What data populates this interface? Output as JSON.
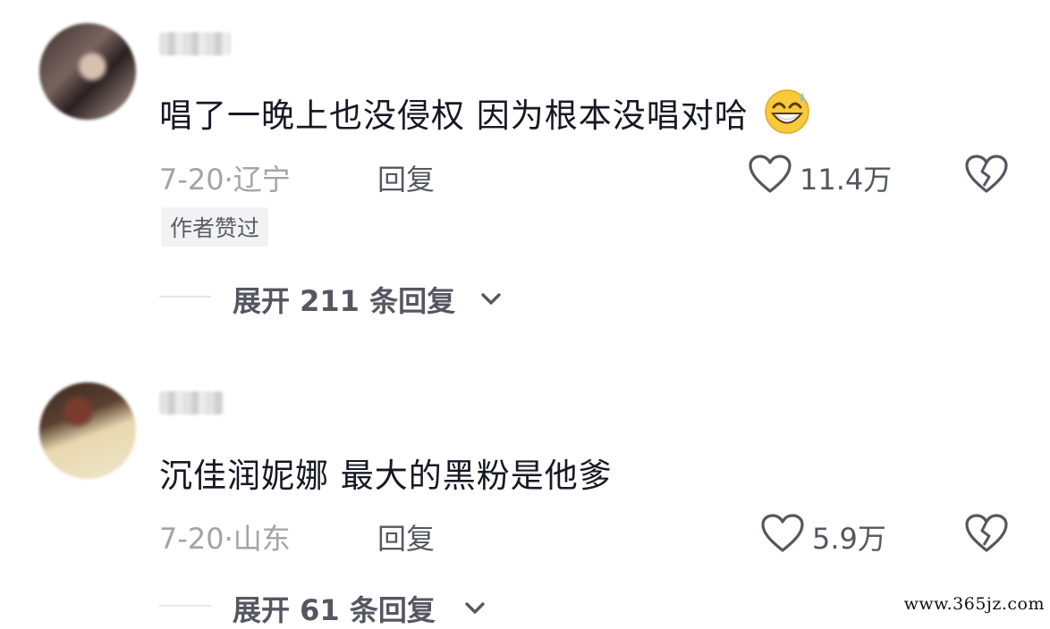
{
  "comments": [
    {
      "username": "",
      "text": "唱了一晚上也没侵权 因为根本没唱对哈",
      "emoji": "grinning-sweat-face",
      "date": "7-20",
      "separator": "·",
      "location": "辽宁",
      "reply_label": "回复",
      "likes": "11.4万",
      "author_badge": "作者赞过",
      "expand_label": "展开 211 条回复"
    },
    {
      "username": "",
      "text": "沉佳润妮娜  最大的黑粉是他爹",
      "date": "7-20",
      "separator": "·",
      "location": "山东",
      "reply_label": "回复",
      "likes": "5.9万",
      "expand_label": "展开 61 条回复"
    }
  ],
  "watermark": "www.365jz.com",
  "colors": {
    "text": "#161823",
    "meta": "#a3a3a8",
    "secondary": "#555760",
    "badge_bg": "#f2f2f4"
  }
}
